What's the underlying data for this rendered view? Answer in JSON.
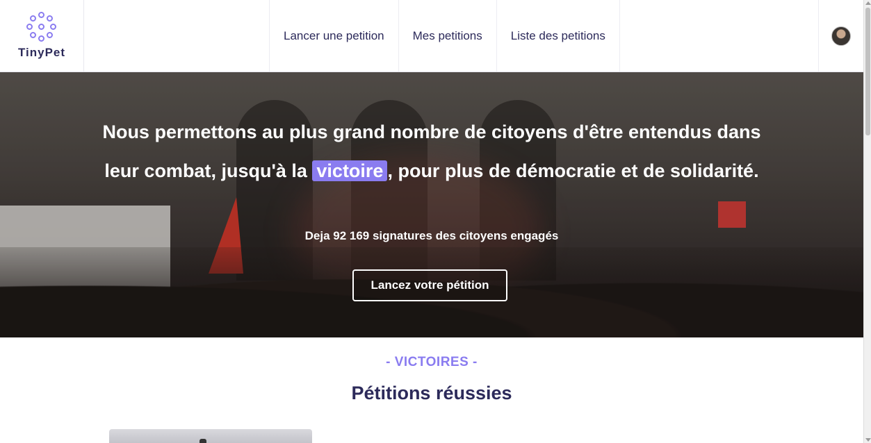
{
  "brand": {
    "name": "TinyPet",
    "accent": "#8a7cf0",
    "text_color": "#2c2a5a"
  },
  "nav": {
    "items": [
      {
        "label": "Lancer une petition"
      },
      {
        "label": "Mes petitions"
      },
      {
        "label": "Liste des petitions"
      }
    ],
    "avatar_icon": "user-avatar"
  },
  "hero": {
    "line1": "Nous permettons au plus grand nombre de citoyens d'être entendus dans",
    "line2_before": "leur combat, jusqu'à la ",
    "line2_highlight": "victoire",
    "line2_after": ", pour plus de démocratie et de solidarité.",
    "signatures_text": "Deja 92 169 signatures des citoyens engagés",
    "cta_label": "Lancez votre pétition"
  },
  "section": {
    "kicker": "- VICTOIRES -",
    "title": "Pétitions réussies"
  }
}
